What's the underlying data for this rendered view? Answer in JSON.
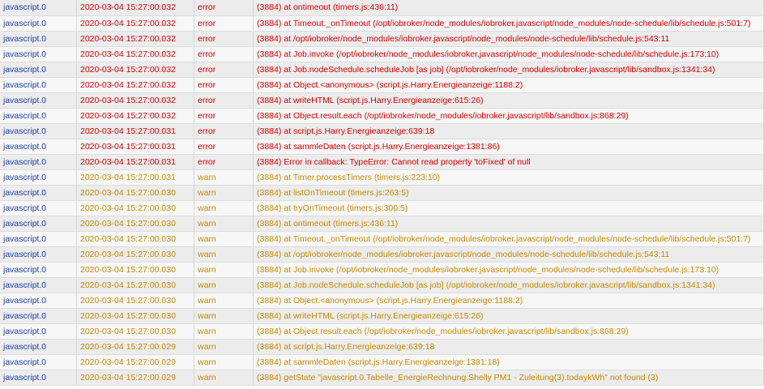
{
  "colors": {
    "source": "#1b3fa6",
    "error": "#d40000",
    "warn": "#c48a00"
  },
  "log": {
    "rows": [
      {
        "source": "javascript.0",
        "time": "2020-03-04 15:27:00.032",
        "severity": "error",
        "message": "(3884) at ontimeout (timers.js:436:11)"
      },
      {
        "source": "javascript.0",
        "time": "2020-03-04 15:27:00.032",
        "severity": "error",
        "message": "(3884) at Timeout._onTimeout (/opt/iobroker/node_modules/iobroker.javascript/node_modules/node-schedule/lib/schedule.js:501:7)"
      },
      {
        "source": "javascript.0",
        "time": "2020-03-04 15:27:00.032",
        "severity": "error",
        "message": "(3884) at /opt/iobroker/node_modules/iobroker.javascript/node_modules/node-schedule/lib/schedule.js:543:11"
      },
      {
        "source": "javascript.0",
        "time": "2020-03-04 15:27:00.032",
        "severity": "error",
        "message": "(3884) at Job.invoke (/opt/iobroker/node_modules/iobroker.javascript/node_modules/node-schedule/lib/schedule.js:173:10)"
      },
      {
        "source": "javascript.0",
        "time": "2020-03-04 15:27:00.032",
        "severity": "error",
        "message": "(3884) at Job.nodeSchedule.scheduleJob [as job] (/opt/iobroker/node_modules/iobroker.javascript/lib/sandbox.js:1341:34)"
      },
      {
        "source": "javascript.0",
        "time": "2020-03-04 15:27:00.032",
        "severity": "error",
        "message": "(3884) at Object.<anonymous> (script.js.Harry.Energieanzeige:1188:2)"
      },
      {
        "source": "javascript.0",
        "time": "2020-03-04 15:27:00.032",
        "severity": "error",
        "message": "(3884) at writeHTML (script.js.Harry.Energieanzeige:615:26)"
      },
      {
        "source": "javascript.0",
        "time": "2020-03-04 15:27:00.032",
        "severity": "error",
        "message": "(3884) at Object.result.each (/opt/iobroker/node_modules/iobroker.javascript/lib/sandbox.js:868:29)"
      },
      {
        "source": "javascript.0",
        "time": "2020-03-04 15:27:00.031",
        "severity": "error",
        "message": "(3884) at script.js.Harry.Energieanzeige:639:18"
      },
      {
        "source": "javascript.0",
        "time": "2020-03-04 15:27:00.031",
        "severity": "error",
        "message": "(3884) at sammleDaten (script.js.Harry.Energieanzeige:1381:86)"
      },
      {
        "source": "javascript.0",
        "time": "2020-03-04 15:27:00.031",
        "severity": "error",
        "message": "(3884) Error in callback: TypeError: Cannot read property 'toFixed' of null"
      },
      {
        "source": "javascript.0",
        "time": "2020-03-04 15:27:00.031",
        "severity": "warn",
        "message": "(3884) at Timer.processTimers (timers.js:223:10)"
      },
      {
        "source": "javascript.0",
        "time": "2020-03-04 15:27:00.030",
        "severity": "warn",
        "message": "(3884) at listOnTimeout (timers.js:263:5)"
      },
      {
        "source": "javascript.0",
        "time": "2020-03-04 15:27:00.030",
        "severity": "warn",
        "message": "(3884) at tryOnTimeout (timers.js:300:5)"
      },
      {
        "source": "javascript.0",
        "time": "2020-03-04 15:27:00.030",
        "severity": "warn",
        "message": "(3884) at ontimeout (timers.js:436:11)"
      },
      {
        "source": "javascript.0",
        "time": "2020-03-04 15:27:00.030",
        "severity": "warn",
        "message": "(3884) at Timeout._onTimeout (/opt/iobroker/node_modules/iobroker.javascript/node_modules/node-schedule/lib/schedule.js:501:7)"
      },
      {
        "source": "javascript.0",
        "time": "2020-03-04 15:27:00.030",
        "severity": "warn",
        "message": "(3884) at /opt/iobroker/node_modules/iobroker.javascript/node_modules/node-schedule/lib/schedule.js:543:11"
      },
      {
        "source": "javascript.0",
        "time": "2020-03-04 15:27:00.030",
        "severity": "warn",
        "message": "(3884) at Job.invoke (/opt/iobroker/node_modules/iobroker.javascript/node_modules/node-schedule/lib/schedule.js:173:10)"
      },
      {
        "source": "javascript.0",
        "time": "2020-03-04 15:27:00.030",
        "severity": "warn",
        "message": "(3884) at Job.nodeSchedule.scheduleJob [as job] (/opt/iobroker/node_modules/iobroker.javascript/lib/sandbox.js:1341:34)"
      },
      {
        "source": "javascript.0",
        "time": "2020-03-04 15:27:00.030",
        "severity": "warn",
        "message": "(3884) at Object.<anonymous> (script.js.Harry.Energieanzeige:1188:2)"
      },
      {
        "source": "javascript.0",
        "time": "2020-03-04 15:27:00.030",
        "severity": "warn",
        "message": "(3884) at writeHTML (script.js.Harry.Energieanzeige:615:26)"
      },
      {
        "source": "javascript.0",
        "time": "2020-03-04 15:27:00.030",
        "severity": "warn",
        "message": "(3884) at Object.result.each (/opt/iobroker/node_modules/iobroker.javascript/lib/sandbox.js:868:29)"
      },
      {
        "source": "javascript.0",
        "time": "2020-03-04 15:27:00.029",
        "severity": "warn",
        "message": "(3884) at script.js.Harry.Energieanzeige:639:18"
      },
      {
        "source": "javascript.0",
        "time": "2020-03-04 15:27:00.029",
        "severity": "warn",
        "message": "(3884) at sammleDaten (script.js.Harry.Energieanzeige:1381:18)"
      },
      {
        "source": "javascript.0",
        "time": "2020-03-04 15:27:00.029",
        "severity": "warn",
        "message": "(3884) getState \"javascript.0.Tabelle_EnergieRechnung.Shelly PM1 - Zuleitung(3).todaykWh\" not found (3)"
      }
    ]
  }
}
